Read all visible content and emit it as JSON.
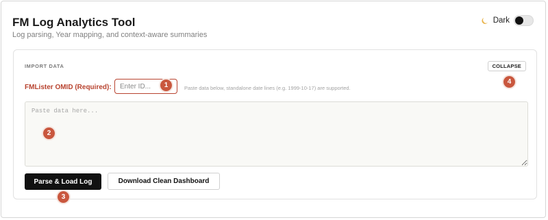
{
  "app": {
    "title": "FM Log Analytics Tool",
    "subtitle": "Log parsing, Year mapping, and context-aware summaries"
  },
  "theme_toggle": {
    "label": "Dark",
    "icon": "moon-icon",
    "enabled": false
  },
  "import_panel": {
    "section_label": "IMPORT DATA",
    "collapse_label": "COLLAPSE",
    "omid_label": "FMLister OMID (Required):",
    "omid_placeholder": "Enter ID...",
    "omid_value": "",
    "hint": "Paste data below, standalone date lines (e.g. 1999-10-17) are supported.",
    "paste_placeholder": "Paste data here...",
    "paste_value": "",
    "parse_button": "Parse & Load Log",
    "download_button": "Download Clean Dashboard"
  },
  "markers": [
    "1",
    "2",
    "3",
    "4"
  ],
  "colors": {
    "accent": "#b8432f",
    "marker": "#c9573e",
    "primary_button": "#111111"
  }
}
